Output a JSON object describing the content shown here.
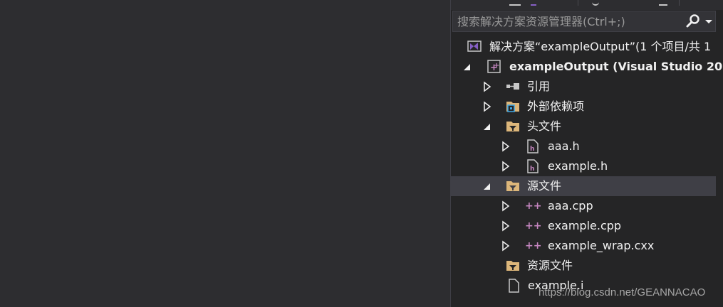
{
  "colors": {
    "background": "#252526",
    "editor": "#2d2d30",
    "text": "#f1f1f1",
    "placeholder": "#999999",
    "folder": "#dcb67a",
    "cpp_accent": "#c586c0",
    "vs_purple": "#865fc5",
    "selected_row": "#3f3f46"
  },
  "search": {
    "placeholder": "搜索解决方案资源管理器(Ctrl+;)",
    "button_icon": "search-icon",
    "dropdown_icon": "chevron-down-icon"
  },
  "tree": {
    "solution": {
      "label": "解决方案“exampleOutput”(1 个项目/共 1",
      "icon": "visual-studio-solution-icon"
    },
    "project": {
      "label": "exampleOutput (Visual Studio 201",
      "icon": "cpp-project-icon",
      "expanded": true
    },
    "references": {
      "label": "引用",
      "icon": "references-icon",
      "expanded": false
    },
    "external_deps": {
      "label": "外部依赖项",
      "icon": "external-dependencies-icon",
      "expanded": false
    },
    "header_files": {
      "label": "头文件",
      "icon": "filter-folder-icon",
      "expanded": true,
      "items": [
        {
          "label": "aaa.h",
          "icon": "header-file-icon"
        },
        {
          "label": "example.h",
          "icon": "header-file-icon"
        }
      ]
    },
    "source_files": {
      "label": "源文件",
      "icon": "filter-folder-icon",
      "expanded": true,
      "selected": true,
      "items": [
        {
          "label": "aaa.cpp",
          "icon": "cpp-file-icon"
        },
        {
          "label": "example.cpp",
          "icon": "cpp-file-icon"
        },
        {
          "label": "example_wrap.cxx",
          "icon": "cpp-file-icon"
        }
      ]
    },
    "resource_files": {
      "label": "资源文件",
      "icon": "filter-folder-icon"
    },
    "example_i": {
      "label": "example.i",
      "icon": "file-icon"
    }
  },
  "watermark": "https://blog.csdn.net/GEANNACAO"
}
